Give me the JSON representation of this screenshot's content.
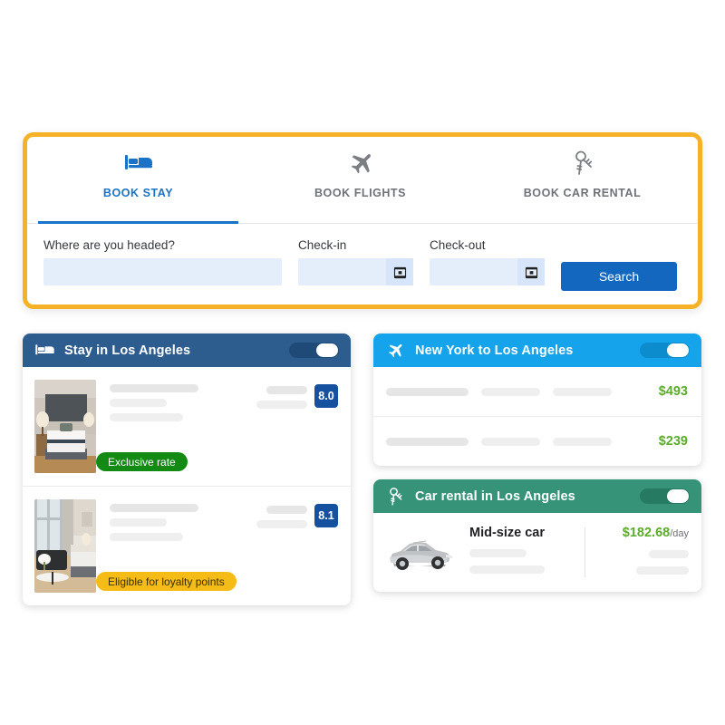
{
  "search_panel": {
    "accent_border": "#F6B227",
    "tabs": [
      {
        "label": "BOOK STAY",
        "icon": "bed-icon",
        "active": true
      },
      {
        "label": "BOOK FLIGHTS",
        "icon": "airplane-icon",
        "active": false
      },
      {
        "label": "BOOK CAR RENTAL",
        "icon": "car-key-icon",
        "active": false
      }
    ],
    "fields": {
      "destination": {
        "label": "Where are you headed?",
        "value": "",
        "placeholder": ""
      },
      "checkin": {
        "label": "Check-in",
        "value": "",
        "placeholder": "",
        "icon": "calendar-icon"
      },
      "checkout": {
        "label": "Check-out",
        "value": "",
        "placeholder": "",
        "icon": "calendar-icon"
      }
    },
    "search_button": "Search"
  },
  "hotel_card": {
    "header": {
      "icon": "bed-icon",
      "title": "Stay in Los Angeles",
      "toggle_on": true
    },
    "header_color": "#2d5c8f",
    "rows": [
      {
        "rating": "8.0",
        "badge": {
          "text": "Exclusive rate",
          "style": "green"
        },
        "image": "hotel-room-photo"
      },
      {
        "rating": "8.1",
        "badge": {
          "text": "Eligible for loyalty points",
          "style": "yellow"
        },
        "image": "hotel-suite-photo"
      }
    ]
  },
  "flight_card": {
    "header": {
      "icon": "airplane-icon",
      "title": "New York to Los Angeles",
      "toggle_on": true
    },
    "header_color": "#15a3eb",
    "rows": [
      {
        "price": "$493"
      },
      {
        "price": "$239"
      }
    ]
  },
  "car_card": {
    "header": {
      "icon": "car-key-icon",
      "title": "Car rental in Los Angeles",
      "toggle_on": true
    },
    "header_color": "#369377",
    "rows": [
      {
        "title": "Mid-size car",
        "price": "$182.68",
        "price_unit": "/day",
        "image": "silver-hatchback-car-photo"
      }
    ]
  }
}
